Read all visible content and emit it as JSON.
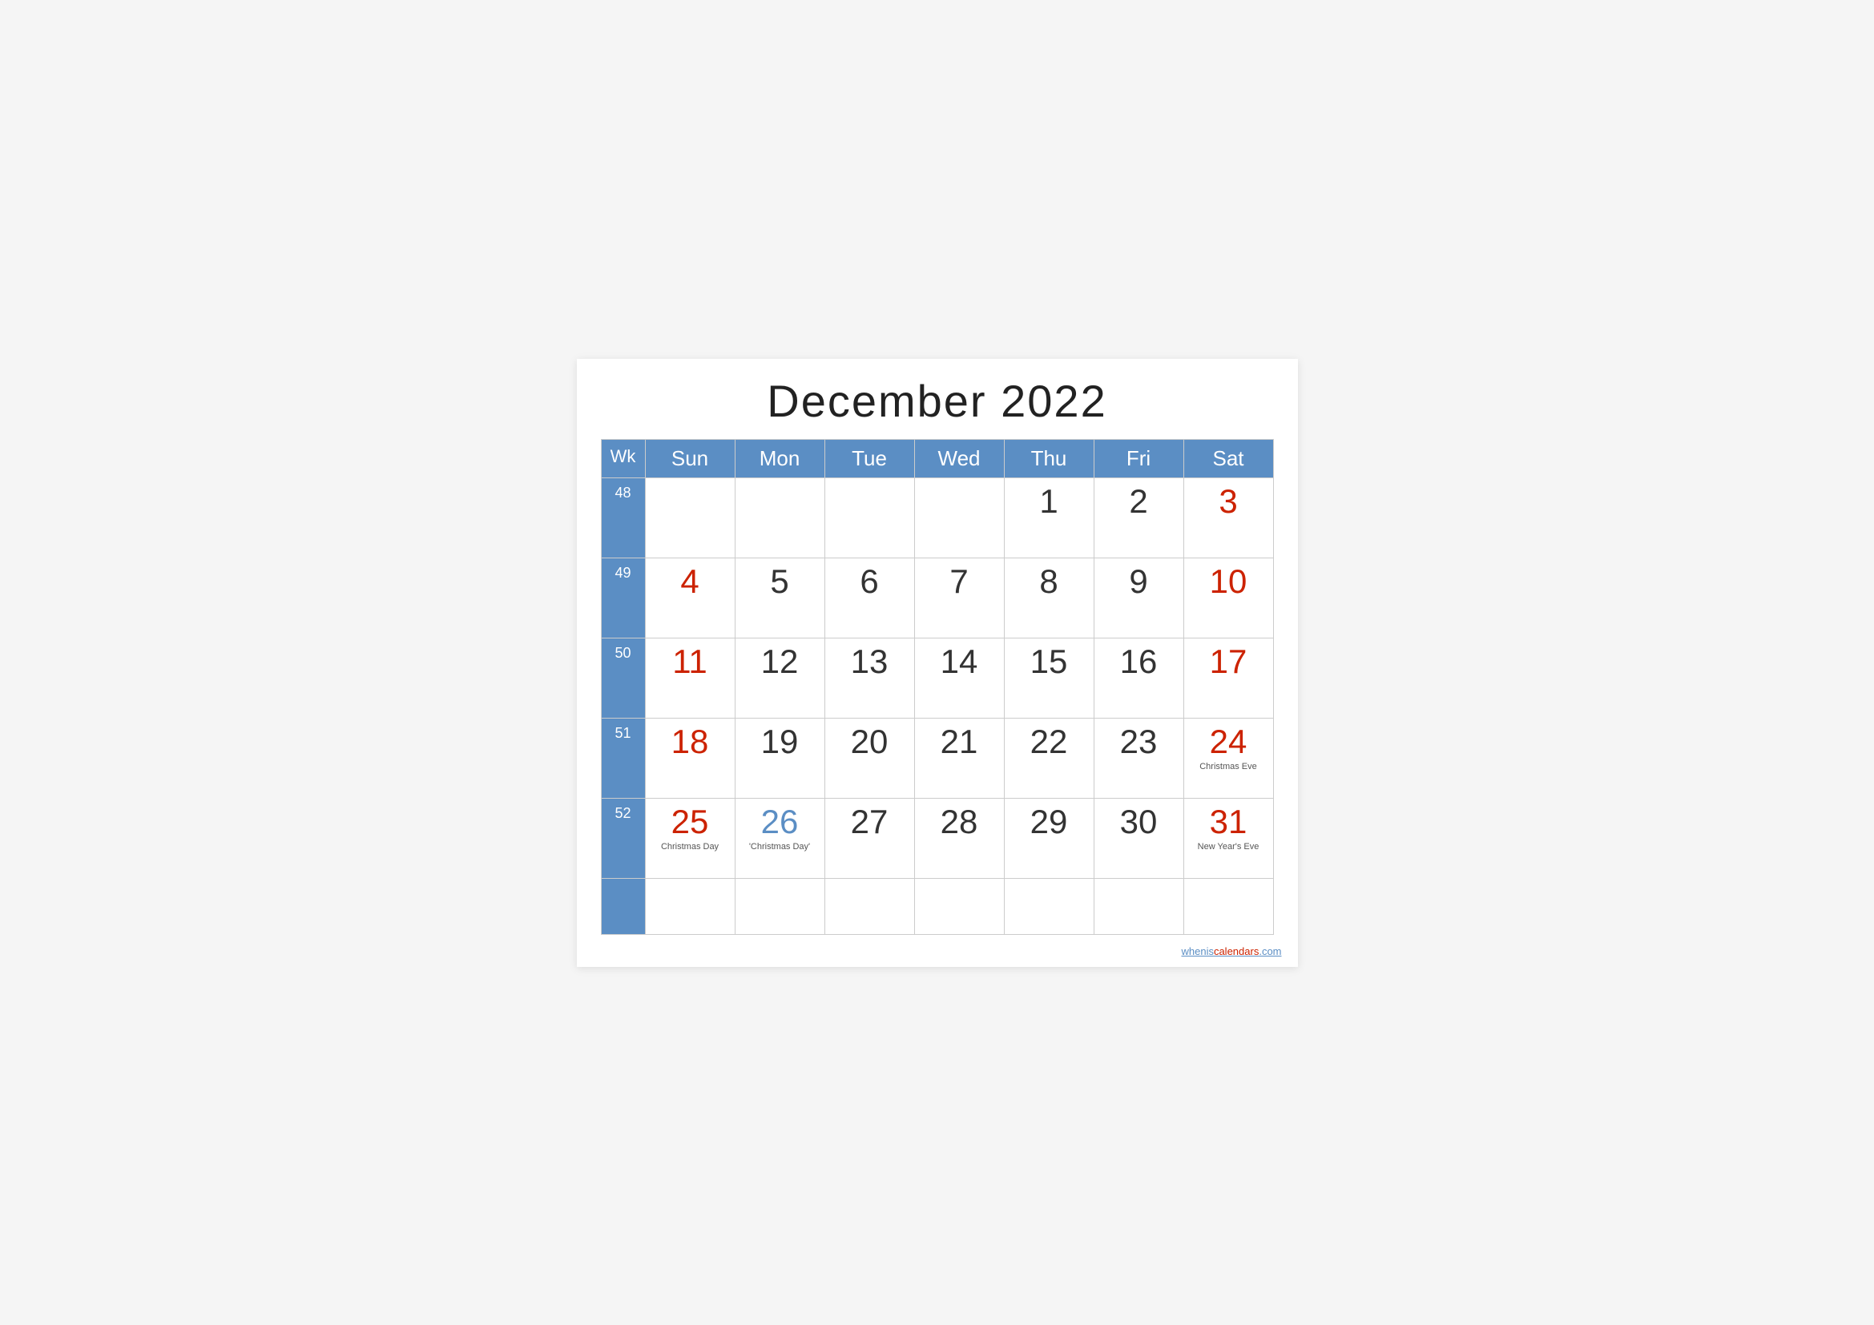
{
  "title": "December 2022",
  "headers": {
    "wk": "Wk",
    "sun": "Sun",
    "mon": "Mon",
    "tue": "Tue",
    "wed": "Wed",
    "thu": "Thu",
    "fri": "Fri",
    "sat": "Sat"
  },
  "weeks": [
    {
      "wk": "48",
      "days": [
        {
          "num": "",
          "color": "black",
          "holiday": ""
        },
        {
          "num": "",
          "color": "black",
          "holiday": ""
        },
        {
          "num": "",
          "color": "black",
          "holiday": ""
        },
        {
          "num": "",
          "color": "black",
          "holiday": ""
        },
        {
          "num": "1",
          "color": "black",
          "holiday": ""
        },
        {
          "num": "2",
          "color": "black",
          "holiday": ""
        },
        {
          "num": "3",
          "color": "red",
          "holiday": ""
        }
      ]
    },
    {
      "wk": "49",
      "days": [
        {
          "num": "4",
          "color": "red",
          "holiday": ""
        },
        {
          "num": "5",
          "color": "black",
          "holiday": ""
        },
        {
          "num": "6",
          "color": "black",
          "holiday": ""
        },
        {
          "num": "7",
          "color": "black",
          "holiday": ""
        },
        {
          "num": "8",
          "color": "black",
          "holiday": ""
        },
        {
          "num": "9",
          "color": "black",
          "holiday": ""
        },
        {
          "num": "10",
          "color": "red",
          "holiday": ""
        }
      ]
    },
    {
      "wk": "50",
      "days": [
        {
          "num": "11",
          "color": "red",
          "holiday": ""
        },
        {
          "num": "12",
          "color": "black",
          "holiday": ""
        },
        {
          "num": "13",
          "color": "black",
          "holiday": ""
        },
        {
          "num": "14",
          "color": "black",
          "holiday": ""
        },
        {
          "num": "15",
          "color": "black",
          "holiday": ""
        },
        {
          "num": "16",
          "color": "black",
          "holiday": ""
        },
        {
          "num": "17",
          "color": "red",
          "holiday": ""
        }
      ]
    },
    {
      "wk": "51",
      "days": [
        {
          "num": "18",
          "color": "red",
          "holiday": ""
        },
        {
          "num": "19",
          "color": "black",
          "holiday": ""
        },
        {
          "num": "20",
          "color": "black",
          "holiday": ""
        },
        {
          "num": "21",
          "color": "black",
          "holiday": ""
        },
        {
          "num": "22",
          "color": "black",
          "holiday": ""
        },
        {
          "num": "23",
          "color": "black",
          "holiday": ""
        },
        {
          "num": "24",
          "color": "red",
          "holiday": "Christmas Eve"
        }
      ]
    },
    {
      "wk": "52",
      "days": [
        {
          "num": "25",
          "color": "red",
          "holiday": "Christmas Day"
        },
        {
          "num": "26",
          "color": "blue",
          "holiday": "'Christmas Day'"
        },
        {
          "num": "27",
          "color": "black",
          "holiday": ""
        },
        {
          "num": "28",
          "color": "black",
          "holiday": ""
        },
        {
          "num": "29",
          "color": "black",
          "holiday": ""
        },
        {
          "num": "30",
          "color": "black",
          "holiday": ""
        },
        {
          "num": "31",
          "color": "red",
          "holiday": "New Year's Eve"
        }
      ]
    }
  ],
  "footer": {
    "text_black": "whenis",
    "text_red": "calendars",
    "text_end": ".com",
    "url": "https://wheniscalendars.com"
  }
}
